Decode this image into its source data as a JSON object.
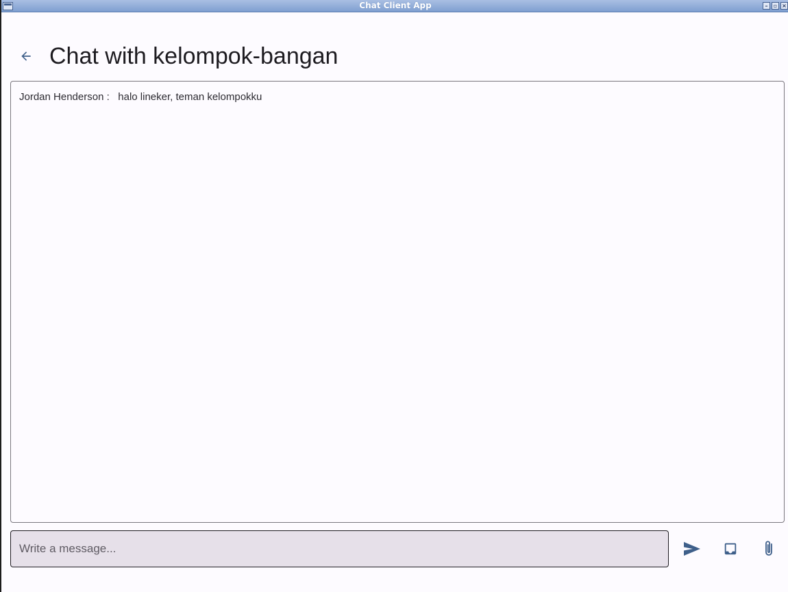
{
  "window": {
    "title": "Chat Client App",
    "controls": [
      "minimize-icon",
      "maximize-icon",
      "close-icon"
    ]
  },
  "header": {
    "back_icon": "arrow-left-icon",
    "title": "Chat with kelompok-bangan"
  },
  "messages": [
    {
      "sender": "Jordan Henderson",
      "separator": " :   ",
      "text": "halo lineker, teman kelompokku"
    }
  ],
  "composer": {
    "placeholder": "Write a message...",
    "value": ""
  },
  "actions": [
    {
      "name": "send-icon"
    },
    {
      "name": "inbox-icon"
    },
    {
      "name": "paperclip-icon"
    }
  ],
  "colors": {
    "accent": "#3e5f8a",
    "background": "#fdfbff",
    "input_fill": "#e6e0e9",
    "titlebar": "#8fabd9"
  }
}
